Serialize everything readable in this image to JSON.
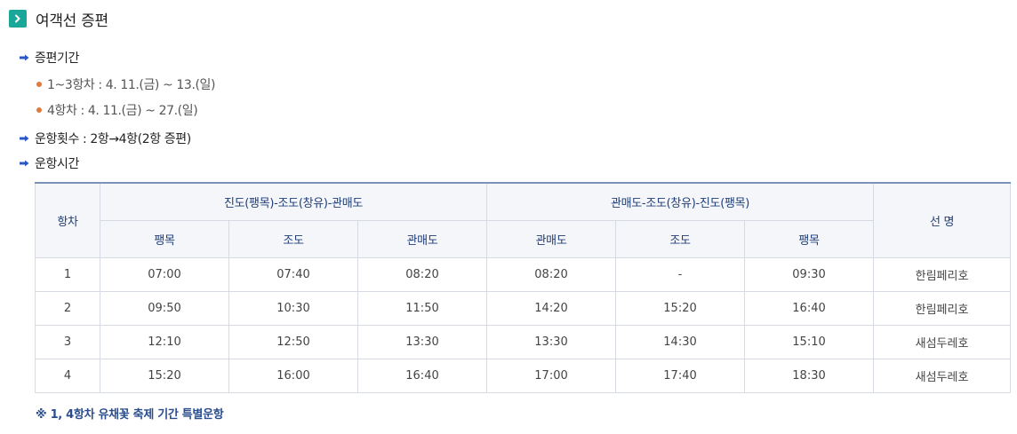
{
  "title": "여객선 증편",
  "sections": {
    "period_label": "증편기간",
    "period_items": [
      "1~3항차 : 4. 11.(금) ~ 13.(일)",
      "4항차 : 4. 11.(금) ~ 27.(일)"
    ],
    "count_label": "운항횟수 : 2항→4항(2항 증편)",
    "time_label": "운항시간"
  },
  "table": {
    "col_trip": "항차",
    "group_out": "진도(팽목)-조도(창유)-관매도",
    "group_in": "관매도-조도(창유)-진도(팽목)",
    "col_ship": "선 명",
    "sub_out": [
      "팽목",
      "조도",
      "관매도"
    ],
    "sub_in": [
      "관매도",
      "조도",
      "팽목"
    ],
    "rows": [
      [
        "1",
        "07:00",
        "07:40",
        "08:20",
        "08:20",
        "-",
        "09:30",
        "한림페리호"
      ],
      [
        "2",
        "09:50",
        "10:30",
        "11:50",
        "14:20",
        "15:20",
        "16:40",
        "한림페리호"
      ],
      [
        "3",
        "12:10",
        "12:50",
        "13:30",
        "13:30",
        "14:30",
        "15:10",
        "새섬두레호"
      ],
      [
        "4",
        "15:20",
        "16:00",
        "16:40",
        "17:00",
        "17:40",
        "18:30",
        "새섬두레호"
      ]
    ]
  },
  "note": "※ 1, 4항차 유채꽃 축제 기간 특별운항",
  "colors": {
    "accent": "#1aa79a",
    "header_text": "#1f3d78",
    "bullet_orange": "#e07a3c",
    "arrow_blue": "#2b57c4"
  }
}
